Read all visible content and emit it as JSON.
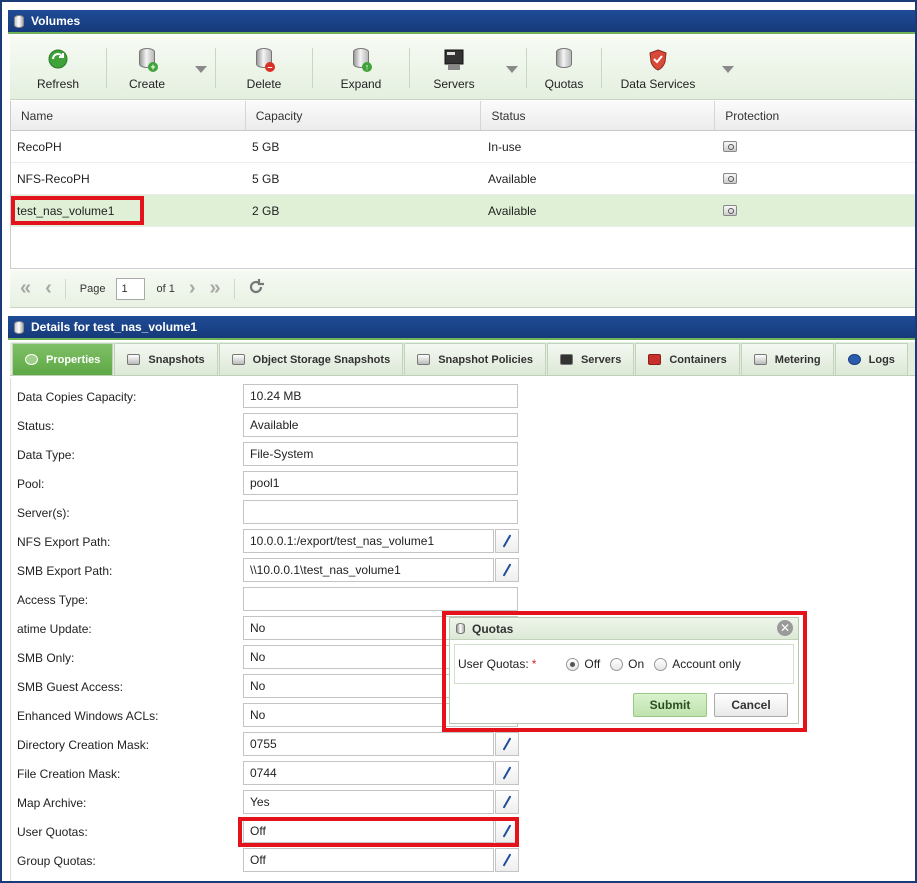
{
  "volumes_panel": {
    "title": "Volumes"
  },
  "toolbar": {
    "refresh": "Refresh",
    "create": "Create",
    "delete": "Delete",
    "expand": "Expand",
    "servers": "Servers",
    "quotas": "Quotas",
    "data_services": "Data Services"
  },
  "table": {
    "columns": [
      "Name",
      "Capacity",
      "Status",
      "Protection"
    ],
    "rows": [
      {
        "name": "RecoPH",
        "capacity": "5 GB",
        "status": "In-use"
      },
      {
        "name": "NFS-RecoPH",
        "capacity": "5 GB",
        "status": "Available"
      },
      {
        "name": "test_nas_volume1",
        "capacity": "2 GB",
        "status": "Available"
      }
    ]
  },
  "pager": {
    "page_label": "Page",
    "page_value": "1",
    "of_label": "of 1"
  },
  "details_panel": {
    "title": "Details for test_nas_volume1"
  },
  "tabs": [
    "Properties",
    "Snapshots",
    "Object Storage Snapshots",
    "Snapshot Policies",
    "Servers",
    "Containers",
    "Metering",
    "Logs"
  ],
  "properties": [
    {
      "label": "Data Copies Capacity:",
      "value": "10.24 MB"
    },
    {
      "label": "Status:",
      "value": "Available"
    },
    {
      "label": "Data Type:",
      "value": "File-System"
    },
    {
      "label": "Pool:",
      "value": "pool1"
    },
    {
      "label": "Server(s):",
      "value": ""
    },
    {
      "label": "NFS Export Path:",
      "value": "10.0.0.1:/export/test_nas_volume1"
    },
    {
      "label": "SMB Export Path:",
      "value": "\\\\10.0.0.1\\test_nas_volume1"
    },
    {
      "label": "Access Type:",
      "value": ""
    },
    {
      "label": "atime Update:",
      "value": "No"
    },
    {
      "label": "SMB Only:",
      "value": "No"
    },
    {
      "label": "SMB Guest Access:",
      "value": "No"
    },
    {
      "label": "Enhanced Windows ACLs:",
      "value": "No"
    },
    {
      "label": "Directory Creation Mask:",
      "value": "0755"
    },
    {
      "label": "File Creation Mask:",
      "value": "0744"
    },
    {
      "label": "Map Archive:",
      "value": "Yes"
    },
    {
      "label": "User Quotas:",
      "value": "Off"
    },
    {
      "label": "Group Quotas:",
      "value": "Off"
    }
  ],
  "quotas_dialog": {
    "title": "Quotas",
    "field_label": "User Quotas:",
    "required_mark": "*",
    "options": [
      "Off",
      "On",
      "Account only"
    ],
    "selected": "Off",
    "submit": "Submit",
    "cancel": "Cancel"
  }
}
